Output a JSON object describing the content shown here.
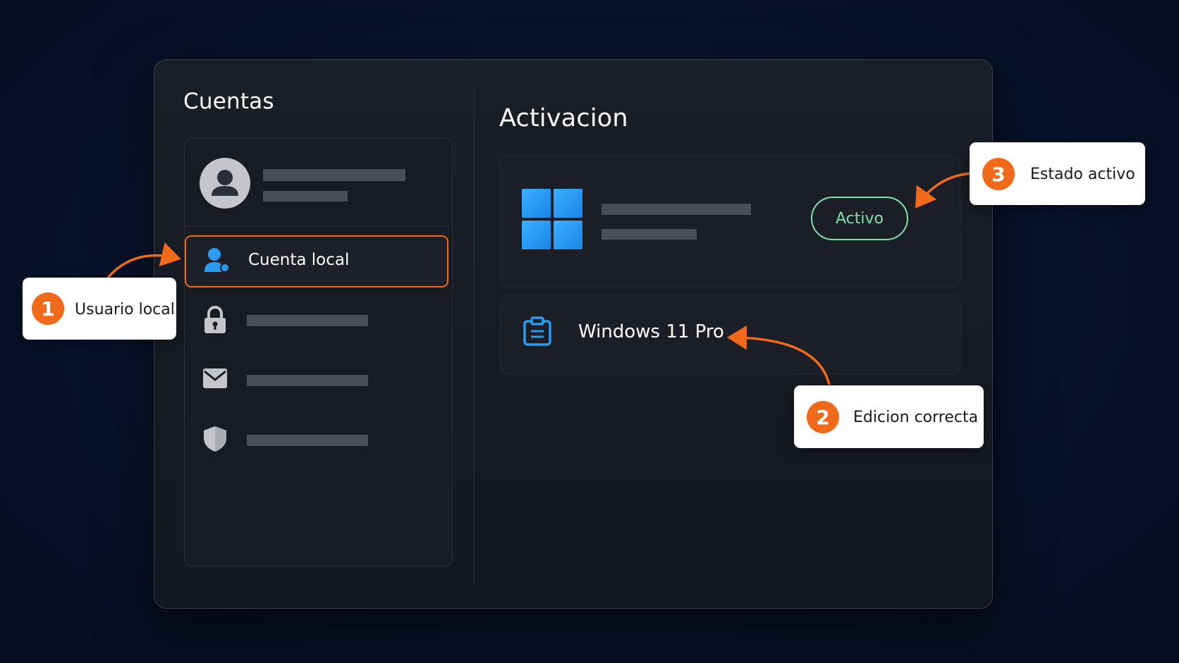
{
  "accounts": {
    "title": "Cuentas",
    "selected_item_label": "Cuenta local",
    "items": [
      {
        "icon": "user-icon",
        "label": "Cuenta local",
        "selected": true
      },
      {
        "icon": "lock-icon",
        "label": ""
      },
      {
        "icon": "mail-icon",
        "label": ""
      },
      {
        "icon": "shield-icon",
        "label": ""
      }
    ]
  },
  "activation": {
    "title": "Activacion",
    "status_label": "Activo",
    "edition_label": "Windows 11 Pro",
    "logo_icon": "windows-logo-icon",
    "edition_icon": "clipboard-icon"
  },
  "callouts": {
    "c1": {
      "number": "1",
      "text": "Usuario local"
    },
    "c2": {
      "number": "2",
      "text": "Edicion correcta"
    },
    "c3": {
      "number": "3",
      "text": "Estado activo"
    }
  },
  "colors": {
    "accent_orange": "#f06a1a",
    "active_green": "#7fe3a6",
    "windows_blue": "#2b9bf0",
    "background": "#08122a"
  }
}
